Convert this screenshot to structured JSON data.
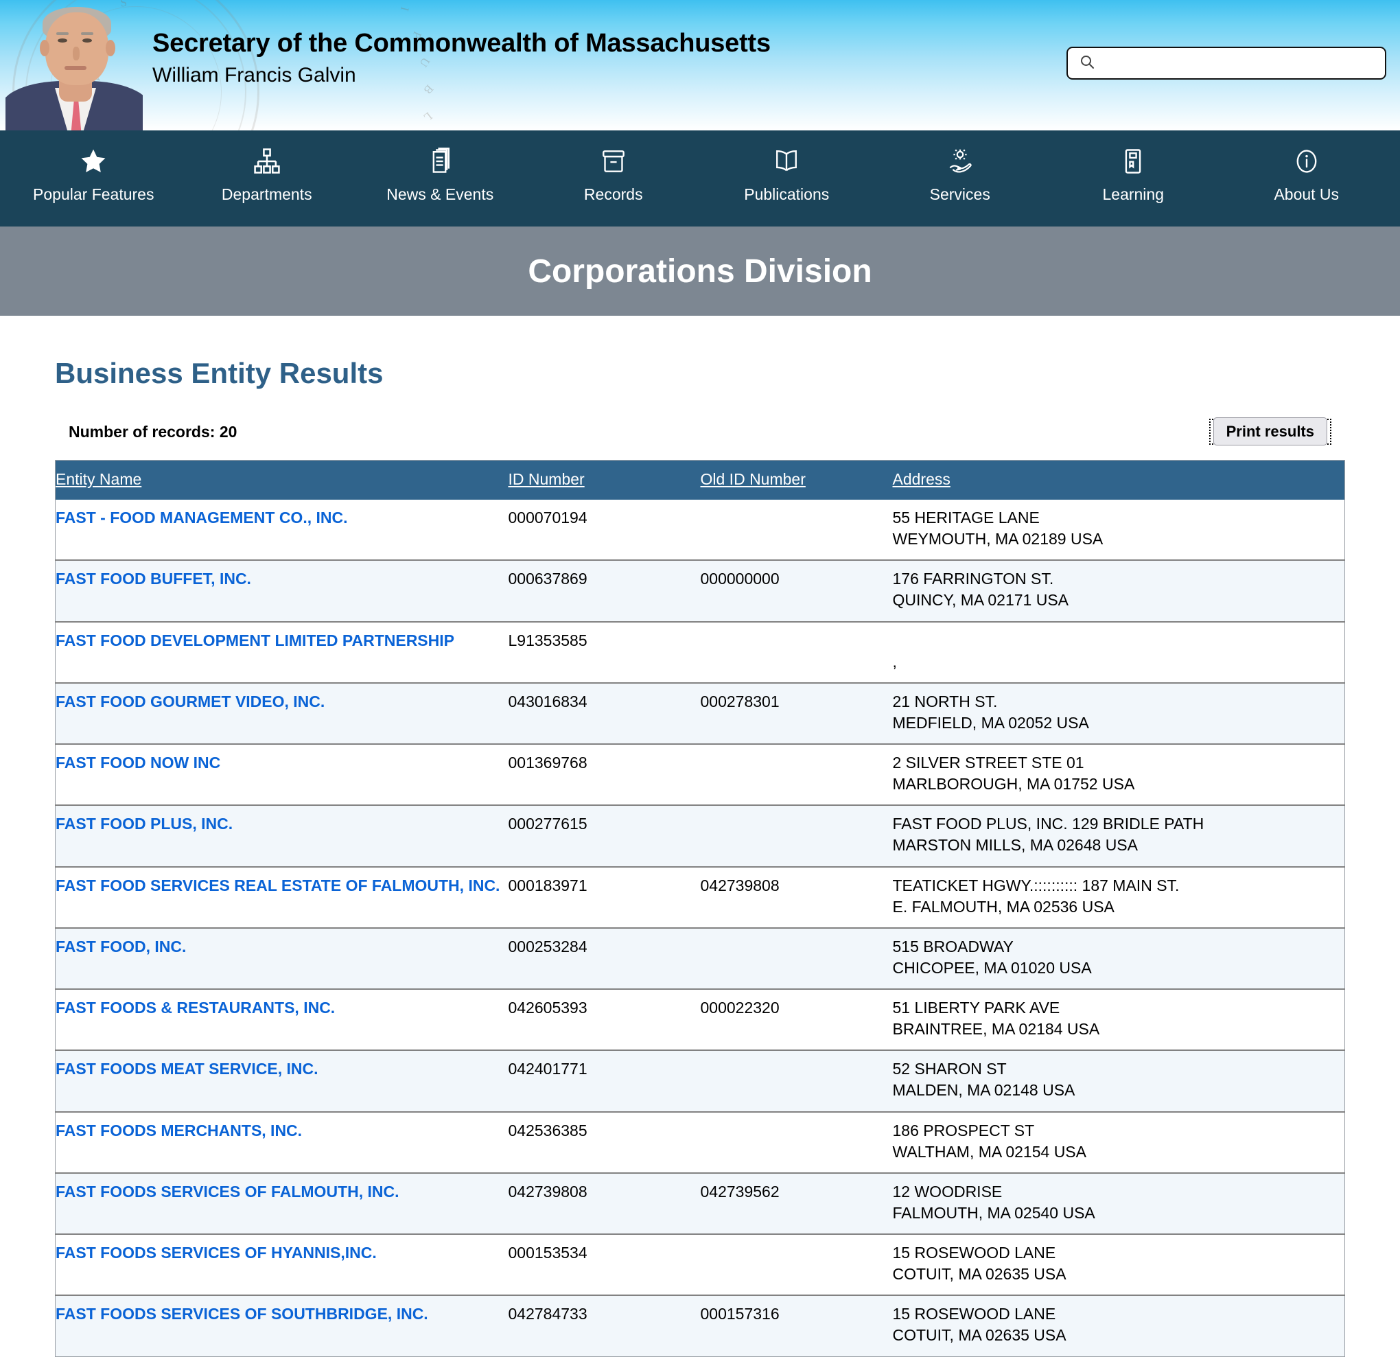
{
  "header": {
    "title": "Secretary of the Commonwealth of Massachusetts",
    "subtitle": "William Francis Galvin",
    "seal_text": "SIGILLUM REIPUBLICAE MASSACHUSETTENSIS",
    "search": {
      "value": "",
      "placeholder": "",
      "icon": "search-icon"
    }
  },
  "nav": {
    "items": [
      {
        "label": "Popular Features",
        "icon": "star-icon"
      },
      {
        "label": "Departments",
        "icon": "org-chart-icon"
      },
      {
        "label": "News & Events",
        "icon": "newspaper-icon"
      },
      {
        "label": "Records",
        "icon": "file-box-icon"
      },
      {
        "label": "Publications",
        "icon": "open-book-icon"
      },
      {
        "label": "Services",
        "icon": "gear-in-hand-icon"
      },
      {
        "label": "Learning",
        "icon": "bookmark-book-icon"
      },
      {
        "label": "About Us",
        "icon": "info-circle-icon"
      }
    ]
  },
  "page_banner": {
    "title": "Corporations Division"
  },
  "main": {
    "results_title": "Business Entity Results",
    "record_count_label": "Number of records: 20",
    "print_button_label": "Print results",
    "columns": [
      "Entity Name",
      "ID Number",
      "Old ID Number",
      "Address"
    ],
    "rows": [
      {
        "name": "FAST - FOOD MANAGEMENT CO., INC.",
        "id": "000070194",
        "old_id": "",
        "address": [
          "55 HERITAGE LANE",
          "WEYMOUTH, MA 02189 USA"
        ]
      },
      {
        "name": "FAST FOOD BUFFET, INC.",
        "id": "000637869",
        "old_id": "000000000",
        "address": [
          "176 FARRINGTON ST.",
          "QUINCY, MA 02171 USA"
        ]
      },
      {
        "name": "FAST FOOD DEVELOPMENT LIMITED PARTNERSHIP",
        "id": "L91353585",
        "old_id": "",
        "address": [
          "",
          ","
        ]
      },
      {
        "name": "FAST FOOD GOURMET VIDEO, INC.",
        "id": "043016834",
        "old_id": "000278301",
        "address": [
          "21 NORTH ST.",
          "MEDFIELD, MA 02052 USA"
        ]
      },
      {
        "name": "FAST FOOD NOW INC",
        "id": "001369768",
        "old_id": "",
        "address": [
          "2 SILVER STREET STE 01",
          "MARLBOROUGH, MA 01752 USA"
        ]
      },
      {
        "name": "FAST FOOD PLUS, INC.",
        "id": "000277615",
        "old_id": "",
        "address": [
          "FAST FOOD PLUS, INC. 129 BRIDLE PATH",
          "MARSTON MILLS, MA 02648 USA"
        ]
      },
      {
        "name": "FAST FOOD SERVICES REAL ESTATE OF FALMOUTH, INC.",
        "id": "000183971",
        "old_id": "042739808",
        "address": [
          "TEATICKET HGWY.:::::::::: 187 MAIN ST.",
          "E. FALMOUTH, MA 02536 USA"
        ]
      },
      {
        "name": "FAST FOOD, INC.",
        "id": "000253284",
        "old_id": "",
        "address": [
          "515 BROADWAY",
          "CHICOPEE, MA 01020 USA"
        ]
      },
      {
        "name": "FAST FOODS & RESTAURANTS, INC.",
        "id": "042605393",
        "old_id": "000022320",
        "address": [
          "51 LIBERTY PARK AVE",
          "BRAINTREE, MA 02184 USA"
        ]
      },
      {
        "name": "FAST FOODS MEAT SERVICE, INC.",
        "id": "042401771",
        "old_id": "",
        "address": [
          "52 SHARON ST",
          "MALDEN, MA 02148 USA"
        ]
      },
      {
        "name": "FAST FOODS MERCHANTS, INC.",
        "id": "042536385",
        "old_id": "",
        "address": [
          "186 PROSPECT ST",
          "WALTHAM, MA 02154 USA"
        ]
      },
      {
        "name": "FAST FOODS SERVICES OF FALMOUTH, INC.",
        "id": "042739808",
        "old_id": "042739562",
        "address": [
          "12 WOODRISE",
          "FALMOUTH, MA 02540 USA"
        ]
      },
      {
        "name": "FAST FOODS SERVICES OF HYANNIS,INC.",
        "id": "000153534",
        "old_id": "",
        "address": [
          "15 ROSEWOOD LANE",
          "COTUIT, MA 02635 USA"
        ]
      },
      {
        "name": "FAST FOODS SERVICES OF SOUTHBRIDGE, INC.",
        "id": "042784733",
        "old_id": "000157316",
        "address": [
          "15 ROSEWOOD LANE",
          "COTUIT, MA 02635 USA"
        ]
      }
    ]
  },
  "colors": {
    "nav_bg": "#1b4459",
    "banner_bg": "#7d8792",
    "table_header_bg": "#30648c",
    "link_blue": "#0a63d6",
    "title_blue": "#2e6088",
    "row_alt_bg": "#f2f7fb"
  }
}
